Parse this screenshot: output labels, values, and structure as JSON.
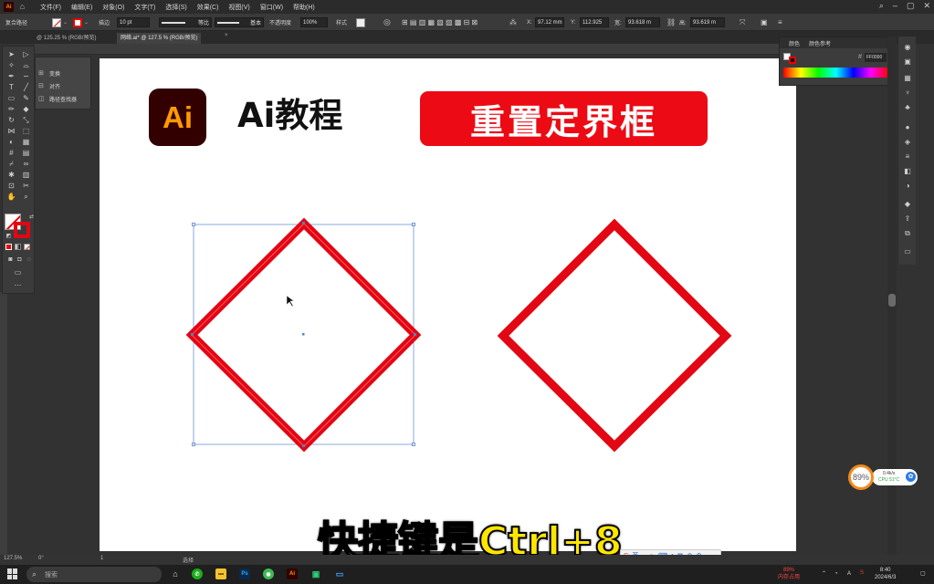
{
  "menubar": {
    "app_badge": "Ai",
    "items": [
      "文件(F)",
      "编辑(E)",
      "对象(O)",
      "文字(T)",
      "选择(S)",
      "效果(C)",
      "视图(V)",
      "窗口(W)",
      "帮助(H)"
    ]
  },
  "control_bar": {
    "selection_label": "复合路径",
    "stroke_label": "描边",
    "stroke_value": "10 pt",
    "uniform_label": "等比",
    "basic_label": "基本",
    "opacity_label": "不透明度",
    "opacity_value": "100%",
    "style_label": "样式",
    "x_label": "X:",
    "x_value": "97.12 mm",
    "y_label": "Y:",
    "y_value": "112.925",
    "w_label": "宽:",
    "w_value": "93.618 m",
    "h_label": "高:",
    "h_value": "93.619 m"
  },
  "tabs": [
    {
      "label": "@ 125.25 % (RGB/预览)",
      "active": false
    },
    {
      "label": "网络.ai* @ 127.5 % (RGB/预览)",
      "active": true
    }
  ],
  "flyout": {
    "items": [
      "变换",
      "对齐",
      "路径查找器"
    ]
  },
  "right_panel": {
    "tab_color": "颜色",
    "tab_color_guide": "颜色参考",
    "hex_value": "FF0000"
  },
  "artboard": {
    "logo_text": "Ai",
    "title": "Ai教程",
    "banner": "重置定界框"
  },
  "subtitle": "快捷键是Ctrl+8",
  "statusbar": {
    "zoom": "127.5%",
    "rotation": "0°",
    "page": "1",
    "tool": "选择"
  },
  "cpu_widget": {
    "percent": "89%",
    "net": "0.4k/s",
    "cpu": "CPU 51°C"
  },
  "taskbar": {
    "search_placeholder": "搜索",
    "memory_percent": "89%",
    "memory_label": "内存占用",
    "ime_lang": "英",
    "time": "8:40",
    "date": "2024/6/3"
  },
  "colors": {
    "accent_red": "#ec0a14",
    "shape_red": "#e30613",
    "selection_blue": "#4f7fd0",
    "ai_orange": "#ff9a00",
    "ai_dark": "#330000"
  },
  "icons": {
    "tools": [
      "selection-icon",
      "direct-selection-icon",
      "magic-wand-icon",
      "lasso-icon",
      "pen-icon",
      "curvature-icon",
      "type-icon",
      "line-icon",
      "rectangle-icon",
      "paintbrush-icon",
      "pencil-icon",
      "eraser-icon",
      "rotate-icon",
      "scale-icon",
      "width-icon",
      "free-transform-icon",
      "shape-builder-icon",
      "perspective-icon",
      "mesh-icon",
      "gradient-icon",
      "eyedropper-icon",
      "blend-icon",
      "symbol-sprayer-icon",
      "graph-icon",
      "artboard-icon",
      "slice-icon",
      "hand-icon",
      "zoom-icon"
    ]
  }
}
